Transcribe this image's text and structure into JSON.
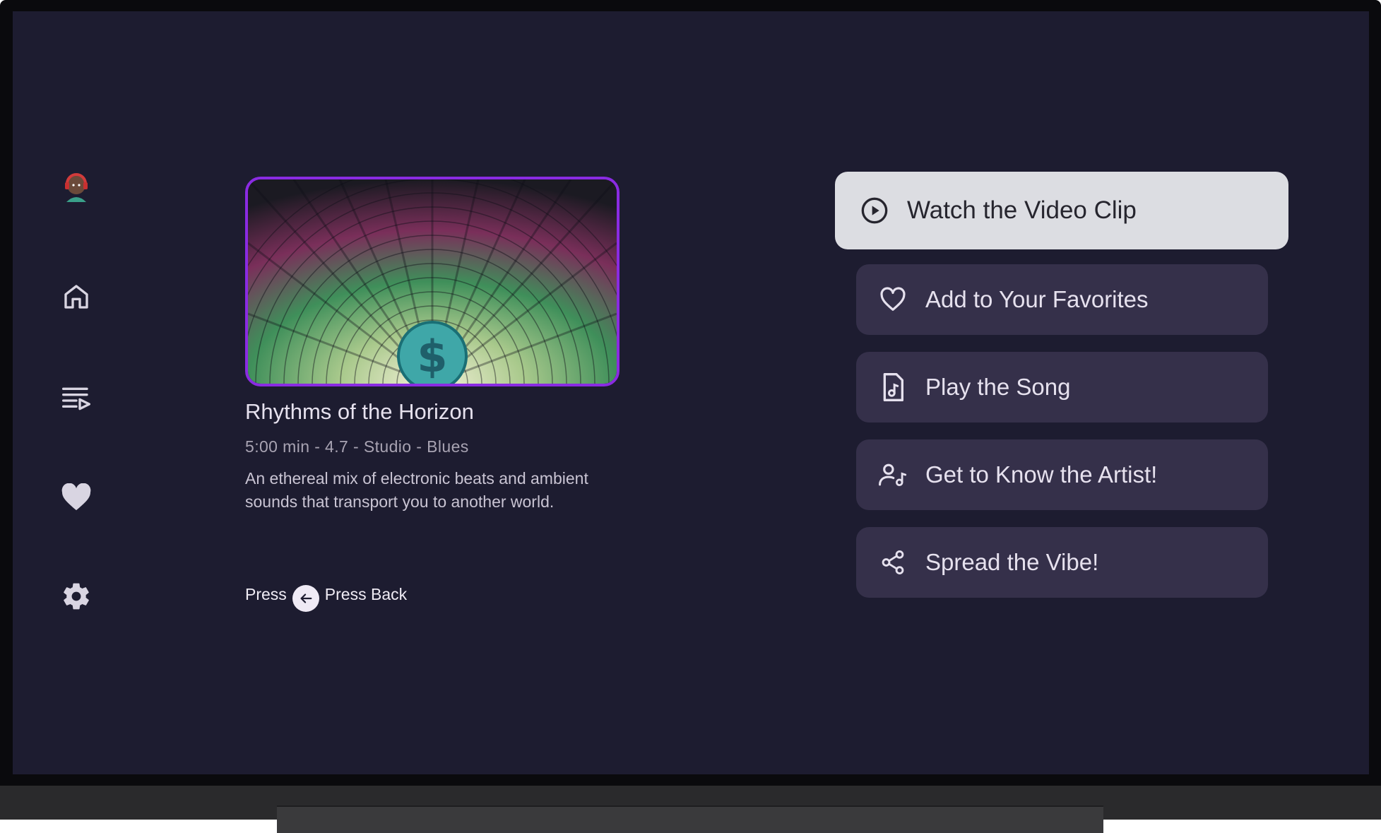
{
  "sidebar": {
    "items": [
      {
        "name": "profile",
        "icon": "avatar-icon"
      },
      {
        "name": "home",
        "icon": "home-icon"
      },
      {
        "name": "playlist",
        "icon": "playlist-icon"
      },
      {
        "name": "favorites",
        "icon": "heart-icon"
      },
      {
        "name": "settings",
        "icon": "gear-icon"
      }
    ]
  },
  "song": {
    "title": "Rhythms of the Horizon",
    "meta": "5:00 min  - 4.7 - Studio - Blues",
    "description": "An ethereal mix of electronic beats and ambient sounds that transport you to another world."
  },
  "back_hint": {
    "press_label": "Press",
    "back_label": "Press Back"
  },
  "actions": [
    {
      "label": "Watch the Video Clip",
      "icon": "play-circle-icon"
    },
    {
      "label": "Add to Your Favorites",
      "icon": "heart-outline-icon"
    },
    {
      "label": "Play the Song",
      "icon": "music-file-icon"
    },
    {
      "label": "Get to Know the Artist!",
      "icon": "artist-icon"
    },
    {
      "label": "Spread the Vibe!",
      "icon": "share-icon"
    }
  ],
  "colors": {
    "background": "#1d1c30",
    "focused_button": "#dcdde2",
    "button": "#35304a",
    "accent_border": "#8a2be2"
  }
}
